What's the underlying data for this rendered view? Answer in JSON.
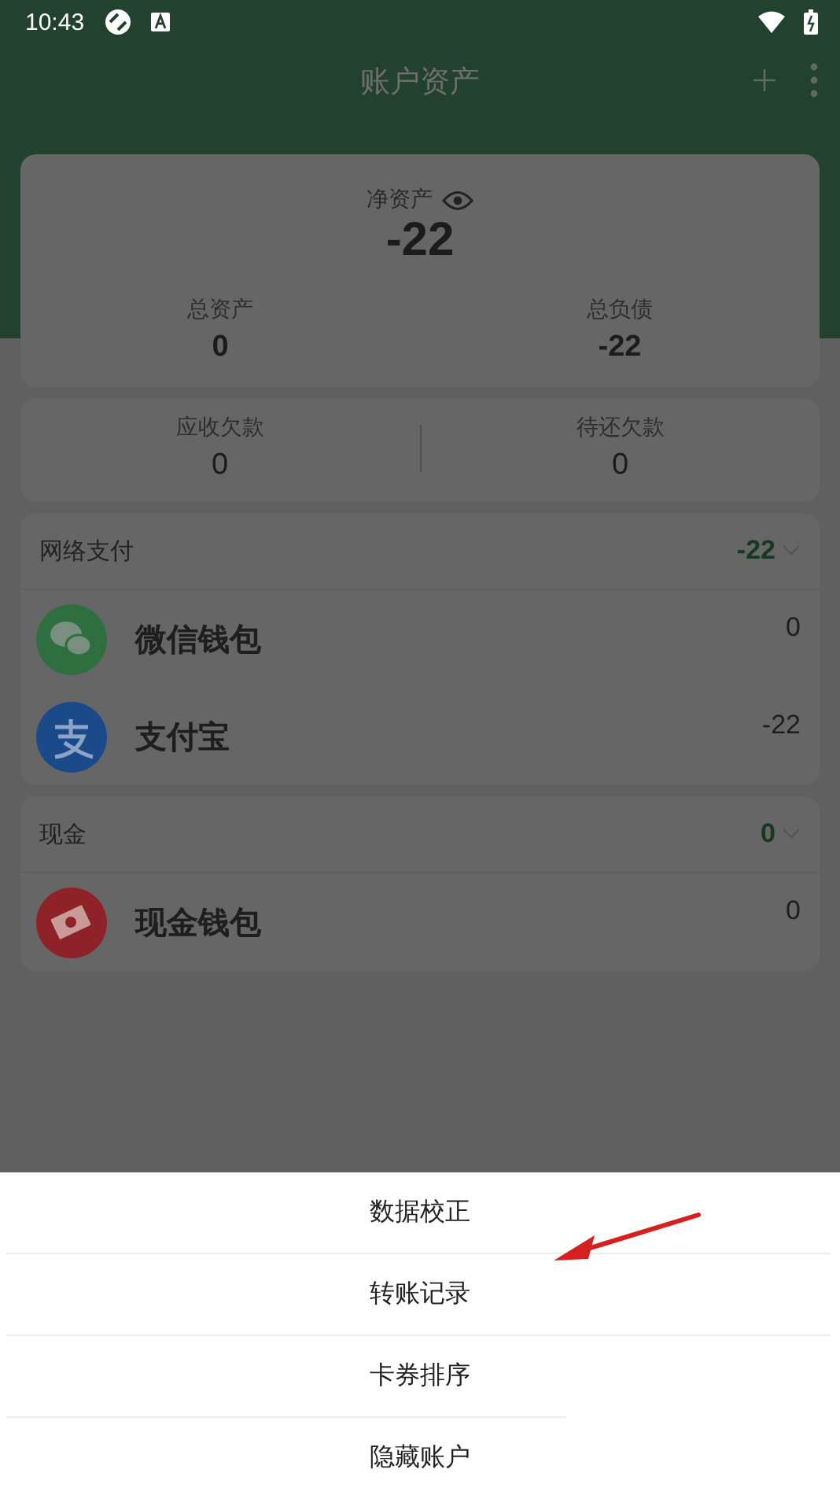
{
  "status_bar": {
    "time": "10:43"
  },
  "header": {
    "title": "账户资产"
  },
  "summary": {
    "net_label": "净资产",
    "net_value": "-22",
    "stats": [
      {
        "label": "总资产",
        "value": "0"
      },
      {
        "label": "总负债",
        "value": "-22"
      }
    ]
  },
  "debts": [
    {
      "label": "应收欠款",
      "value": "0"
    },
    {
      "label": "待还欠款",
      "value": "0"
    }
  ],
  "groups": [
    {
      "name": "网络支付",
      "total": "-22",
      "accounts": [
        {
          "kind": "wechat",
          "name": "微信钱包",
          "balance": "0"
        },
        {
          "kind": "alipay",
          "name": "支付宝",
          "balance": "-22"
        }
      ]
    },
    {
      "name": "现金",
      "total": "0",
      "accounts": [
        {
          "kind": "cash",
          "name": "现金钱包",
          "balance": "0"
        }
      ]
    }
  ],
  "menu": [
    "数据校正",
    "转账记录",
    "卡券排序",
    "隐藏账户"
  ]
}
